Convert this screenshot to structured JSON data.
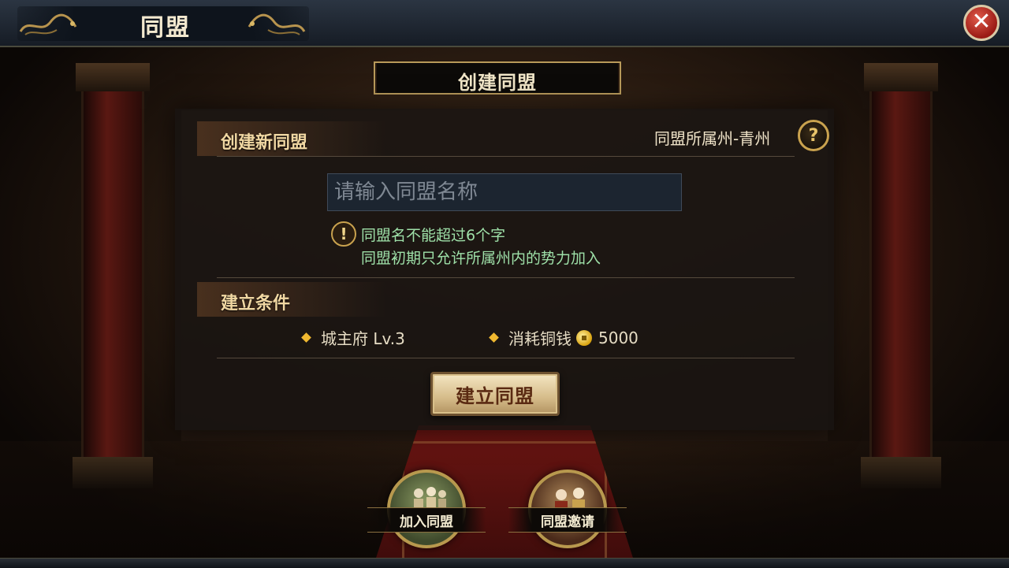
{
  "header": {
    "title": "同盟",
    "close_icon": "close-icon"
  },
  "banner": {
    "title": "创建同盟"
  },
  "create_section": {
    "title": "创建新同盟",
    "region_label": "同盟所属州-青州",
    "help_icon": "help-icon",
    "name_input": {
      "placeholder": "请输入同盟名称",
      "value": ""
    },
    "hints": [
      "同盟名不能超过6个字",
      "同盟初期只允许所属州内的势力加入"
    ]
  },
  "conditions_section": {
    "title": "建立条件",
    "items": [
      {
        "label": "城主府 Lv.3"
      },
      {
        "label": "消耗铜钱",
        "amount": "5000",
        "icon": "coin-icon"
      }
    ]
  },
  "actions": {
    "create_label": "建立同盟"
  },
  "bottom_nav": [
    {
      "label": "加入同盟",
      "icon": "join-alliance-icon"
    },
    {
      "label": "同盟邀请",
      "icon": "alliance-invite-icon"
    }
  ],
  "colors": {
    "hint_green": "#9ee0a8",
    "gold_accent": "#c9a24e",
    "close_red": "#9a1a14"
  }
}
